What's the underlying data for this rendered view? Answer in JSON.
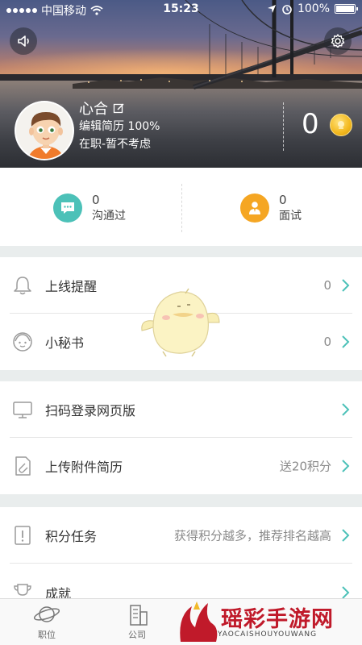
{
  "status_bar": {
    "carrier": "中国移动",
    "time": "15:23",
    "battery": "100%"
  },
  "profile": {
    "name": "心合",
    "resume_completion": "编辑简历 100%",
    "job_status": "在职-暂不考虑",
    "coins": "0"
  },
  "stats": [
    {
      "count": "0",
      "label": "沟通过",
      "icon": "chat-bubble-icon",
      "color": "#4cc1b8"
    },
    {
      "count": "0",
      "label": "面试",
      "icon": "interview-person-icon",
      "color": "#f5a623"
    }
  ],
  "menu_groups": [
    [
      {
        "label": "上线提醒",
        "value": "0",
        "icon": "bell-icon"
      },
      {
        "label": "小秘书",
        "value": "0",
        "icon": "secretary-icon"
      }
    ],
    [
      {
        "label": "扫码登录网页版",
        "value": "",
        "icon": "monitor-icon"
      },
      {
        "label": "上传附件简历",
        "value": "送20积分",
        "icon": "attachment-file-icon"
      }
    ],
    [
      {
        "label": "积分任务",
        "value": "获得积分越多，推荐排名越高",
        "icon": "points-task-icon"
      },
      {
        "label": "成就",
        "value": "",
        "icon": "trophy-icon"
      }
    ]
  ],
  "tab_bar": [
    {
      "label": "职位",
      "icon": "planet-icon"
    },
    {
      "label": "公司",
      "icon": "building-icon"
    }
  ],
  "watermark": {
    "title": "瑶彩手游网",
    "subtitle": "YAOCAISHOUYOUWANG"
  },
  "colors": {
    "accent": "#4cc1b8",
    "chevron": "#4cc1b8",
    "section_gap": "#e9eded"
  }
}
